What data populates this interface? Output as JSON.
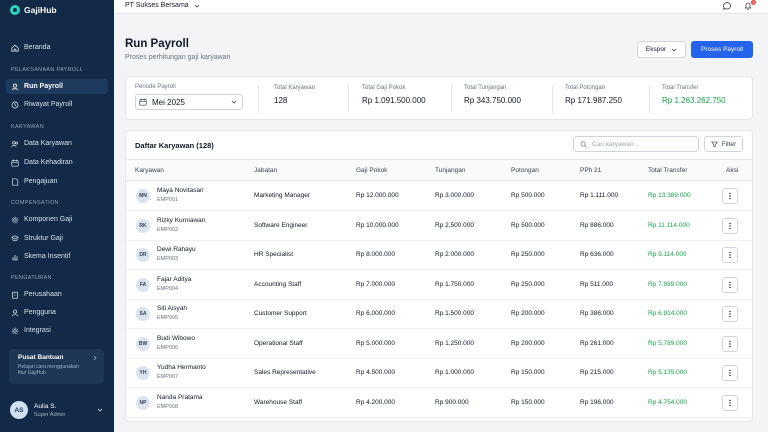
{
  "app": {
    "name": "GajiHub"
  },
  "sidebar": {
    "items_top": [
      {
        "label": "Beranda",
        "icon": "home-icon"
      }
    ],
    "sections": [
      {
        "title": "PELAKSANAAN PAYROLL",
        "items": [
          {
            "label": "Run Payroll",
            "icon": "user-icon",
            "active": true
          },
          {
            "label": "Riwayat Payroll",
            "icon": "history-icon"
          }
        ]
      },
      {
        "title": "KARYAWAN",
        "items": [
          {
            "label": "Data Karyawan",
            "icon": "users-icon"
          },
          {
            "label": "Data Kehadiran",
            "icon": "calendar-icon"
          },
          {
            "label": "Pengajuan",
            "icon": "file-icon"
          }
        ]
      },
      {
        "title": "COMPENSATION",
        "items": [
          {
            "label": "Komponen Gaji",
            "icon": "gear-icon"
          },
          {
            "label": "Struktur Gaji",
            "icon": "layers-icon"
          },
          {
            "label": "Skema Insentif",
            "icon": "chart-icon"
          }
        ]
      },
      {
        "title": "PENGATURAN",
        "items": [
          {
            "label": "Perusahaan",
            "icon": "building-icon"
          },
          {
            "label": "Pengguna",
            "icon": "user-icon"
          },
          {
            "label": "Integrasi",
            "icon": "gear-icon"
          }
        ]
      }
    ],
    "help": {
      "title": "Pusat Bantuan",
      "subtitle": "Pelajari cara menggunakan fitur GajiHub"
    },
    "user": {
      "initials": "AS",
      "name": "Aulia S.",
      "role": "Super Admin"
    }
  },
  "topbar": {
    "company": "PT Sukses Bersama",
    "notification_count": "3"
  },
  "header": {
    "title": "Run Payroll",
    "subtitle": "Proses perhitungan gaji karyawan",
    "export_label": "Ekspor",
    "process_label": "Proses Payroll"
  },
  "summary": {
    "period_label": "Periode Payroll",
    "period_value": "Mei 2025",
    "stats": [
      {
        "label": "Total Karyawan",
        "value": "128",
        "color": "#111827"
      },
      {
        "label": "Total Gaji Pokok",
        "value": "Rp 1.091.500.000",
        "color": "#111827"
      },
      {
        "label": "Total Tunjangan",
        "value": "Rp 343.750.000",
        "color": "#111827"
      },
      {
        "label": "Total Potongan",
        "value": "Rp 171.987.250",
        "color": "#111827"
      },
      {
        "label": "Total Transfer",
        "value": "Rp 1.263.262.750",
        "color": "#16a34a"
      }
    ]
  },
  "table": {
    "title": "Daftar Karyawan (128)",
    "search_placeholder": "Cari karyawan...",
    "filter_label": "Filter",
    "headers": [
      "Karyawan",
      "Jabatan",
      "Gaji Pokok",
      "Tunjangan",
      "Potongan",
      "PPh 21",
      "Total Transfer",
      "Aksi"
    ],
    "rows": [
      {
        "initials": "MN",
        "name": "Maya Novitasari",
        "id": "EMP001",
        "jabatan": "Marketing Manager",
        "gaji": "Rp 12.000.000",
        "tunjangan": "Rp 3.000.000",
        "potongan": "Rp 500.000",
        "pph": "Rp 1.111.000",
        "total": "Rp 13.389.000"
      },
      {
        "initials": "RK",
        "name": "Rizky Kurniawan",
        "id": "EMP002",
        "jabatan": "Software Engineer",
        "gaji": "Rp 10.000.000",
        "tunjangan": "Rp 2.500.000",
        "potongan": "Rp 500.000",
        "pph": "Rp 886.000",
        "total": "Rp 11.114.000"
      },
      {
        "initials": "DR",
        "name": "Dewi Rahayu",
        "id": "EMP003",
        "jabatan": "HR Specialist",
        "gaji": "Rp 8.000.000",
        "tunjangan": "Rp 2.000.000",
        "potongan": "Rp 250.000",
        "pph": "Rp 636.000",
        "total": "Rp 9.114.000"
      },
      {
        "initials": "FA",
        "name": "Fajar Aditya",
        "id": "EMP004",
        "jabatan": "Accounting Staff",
        "gaji": "Rp 7.000.000",
        "tunjangan": "Rp 1.750.000",
        "potongan": "Rp 250.000",
        "pph": "Rp 511.000",
        "total": "Rp 7.989.000"
      },
      {
        "initials": "SA",
        "name": "Siti Aisyah",
        "id": "EMP005",
        "jabatan": "Customer Support",
        "gaji": "Rp 6.000.000",
        "tunjangan": "Rp 1.500.000",
        "potongan": "Rp 200.000",
        "pph": "Rp 386.000",
        "total": "Rp 6.914.000"
      },
      {
        "initials": "BW",
        "name": "Budi Wibowo",
        "id": "EMP006",
        "jabatan": "Operational Staff",
        "gaji": "Rp 5.000.000",
        "tunjangan": "Rp 1.250.000",
        "potongan": "Rp 200.000",
        "pph": "Rp 261.000",
        "total": "Rp 5.789.000"
      },
      {
        "initials": "YH",
        "name": "Yudha Hermanto",
        "id": "EMP007",
        "jabatan": "Sales Representative",
        "gaji": "Rp 4.500.000",
        "tunjangan": "Rp 1.000.000",
        "potongan": "Rp 150.000",
        "pph": "Rp 215.000",
        "total": "Rp 5.135.000"
      },
      {
        "initials": "NP",
        "name": "Nanda Pratama",
        "id": "EMP008",
        "jabatan": "Warehouse Staff",
        "gaji": "Rp 4.200.000",
        "tunjangan": "Rp 900.000",
        "potongan": "Rp 150.000",
        "pph": "Rp 196.000",
        "total": "Rp 4.754.000"
      }
    ]
  }
}
